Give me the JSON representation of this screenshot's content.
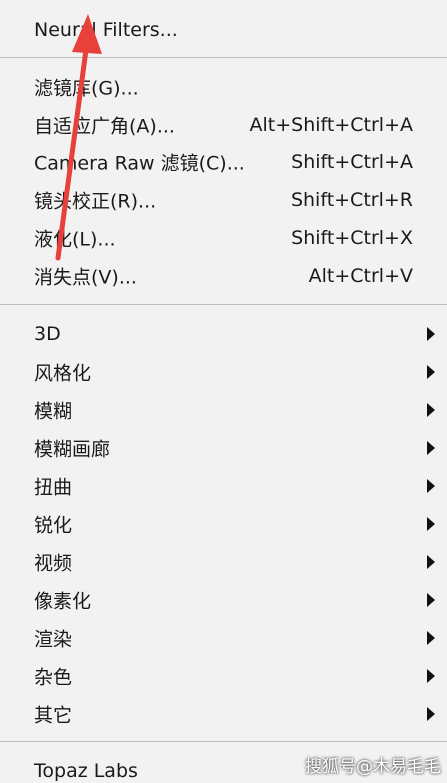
{
  "menu": {
    "group1": [
      {
        "label": "Neural Filters..."
      }
    ],
    "group2": [
      {
        "label": "滤镜库(G)...",
        "shortcut": ""
      },
      {
        "label": "自适应广角(A)...",
        "shortcut": "Alt+Shift+Ctrl+A"
      },
      {
        "label": "Camera Raw 滤镜(C)...",
        "shortcut": "Shift+Ctrl+A"
      },
      {
        "label": "镜头校正(R)...",
        "shortcut": "Shift+Ctrl+R"
      },
      {
        "label": "液化(L)...",
        "shortcut": "Shift+Ctrl+X"
      },
      {
        "label": "消失点(V)...",
        "shortcut": "Alt+Ctrl+V"
      }
    ],
    "group3": [
      {
        "label": "3D"
      },
      {
        "label": "风格化"
      },
      {
        "label": "模糊"
      },
      {
        "label": "模糊画廊"
      },
      {
        "label": "扭曲"
      },
      {
        "label": "锐化"
      },
      {
        "label": "视频"
      },
      {
        "label": "像素化"
      },
      {
        "label": "渲染"
      },
      {
        "label": "杂色"
      },
      {
        "label": "其它"
      }
    ],
    "group4": [
      {
        "label": "Topaz Labs"
      }
    ]
  },
  "annotation": {
    "arrow_color": "#e8403a"
  },
  "watermark": "搜狐号@木易毛毛"
}
